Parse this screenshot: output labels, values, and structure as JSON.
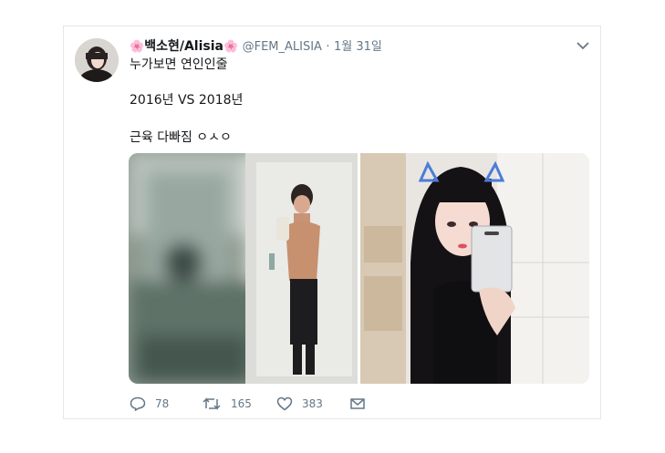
{
  "tweet": {
    "display_name": "백소현/Alisia",
    "flower_left": "🌸",
    "flower_right": "🌸",
    "handle": "@FEM_ALISIA",
    "separator": "·",
    "date": "1월 31일",
    "lines": [
      "누가보면 연인인줄",
      "2016년 VS 2018년",
      "근육 다빠짐 ㅇㅅㅇ"
    ]
  },
  "actions": {
    "reply_count": "78",
    "retweet_count": "165",
    "like_count": "383"
  },
  "icons": {
    "menu": "chevron-down-icon",
    "reply": "reply-icon",
    "retweet": "retweet-icon",
    "like": "heart-icon",
    "dm": "envelope-icon"
  },
  "colors": {
    "text": "#14171a",
    "secondary": "#657786",
    "border": "#e1e8ed",
    "flower": "#e88aa6"
  }
}
